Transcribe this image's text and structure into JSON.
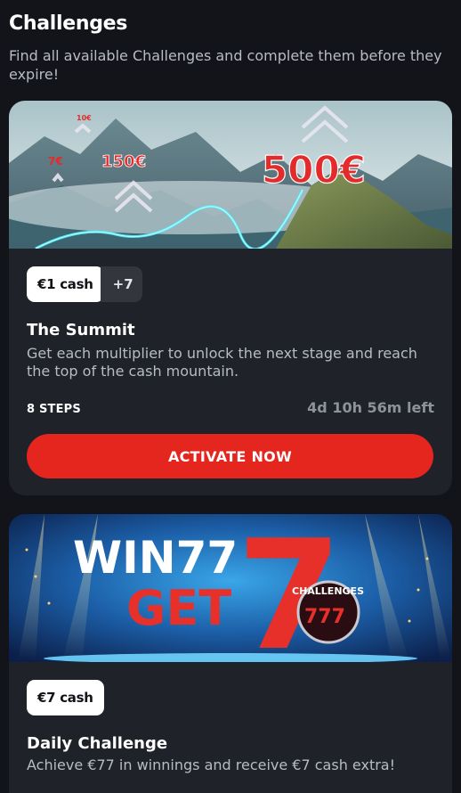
{
  "header": {
    "title": "Challenges",
    "subtitle": "Find all available Challenges and complete them before they expire!"
  },
  "challenges": [
    {
      "banner": {
        "prize_main": "500€",
        "prize_mid": "150€",
        "prize_low": "7€",
        "prize_tiny": "10€"
      },
      "cash_badge": "€1 cash",
      "more_badge": "+7",
      "title": "The Summit",
      "description": "Get each multiplier to unlock the next stage and reach the top of the cash mountain.",
      "steps": "8 STEPS",
      "time_left": "4d 10h 56m left",
      "cta": "ACTIVATE NOW"
    },
    {
      "banner": {
        "line1": "WIN77",
        "line2": "GET",
        "big_seven": "7",
        "emblem_top": "CHALLENGES",
        "emblem_digits": "777"
      },
      "cash_badge": "€7 cash",
      "title": "Daily Challenge",
      "description": "Achieve €77 in winnings and receive €7 cash extra!"
    }
  ],
  "colors": {
    "background": "#12141a",
    "card": "#1f2229",
    "accent_red": "#e4261f",
    "muted_text": "#b7bcc4"
  }
}
